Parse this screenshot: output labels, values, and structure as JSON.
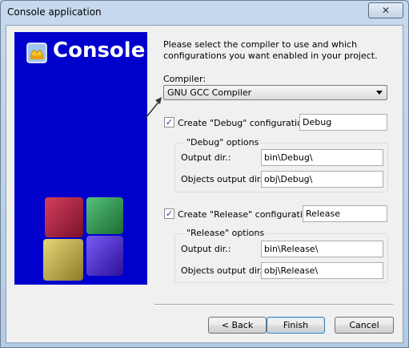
{
  "window": {
    "title": "Console application",
    "close_glyph": "✕"
  },
  "banner": {
    "title": "Console",
    "icon": "codeblocks-shell-icon",
    "background": "#0000cc",
    "cube_colors": [
      "#b5213f",
      "#2f9a4f",
      "#c9b54a",
      "#4b2ad0"
    ]
  },
  "intro": "Please select the compiler to use and which configurations you want enabled in your project.",
  "compiler": {
    "label": "Compiler:",
    "value": "GNU GCC Compiler"
  },
  "debug": {
    "checkbox_label": "Create \"Debug\" configuration:",
    "checked": true,
    "name": "Debug",
    "group_title": "\"Debug\" options",
    "output_dir_label": "Output dir.:",
    "output_dir": "bin\\Debug\\",
    "objects_dir_label": "Objects output dir.:",
    "objects_dir": "obj\\Debug\\"
  },
  "release": {
    "checkbox_label": "Create \"Release\" configuration:",
    "checked": true,
    "name": "Release",
    "group_title": "\"Release\" options",
    "output_dir_label": "Output dir.:",
    "output_dir": "bin\\Release\\",
    "objects_dir_label": "Objects output dir.:",
    "objects_dir": "obj\\Release\\"
  },
  "buttons": {
    "back": "< Back",
    "finish": "Finish",
    "cancel": "Cancel"
  },
  "check_glyph": "✓"
}
